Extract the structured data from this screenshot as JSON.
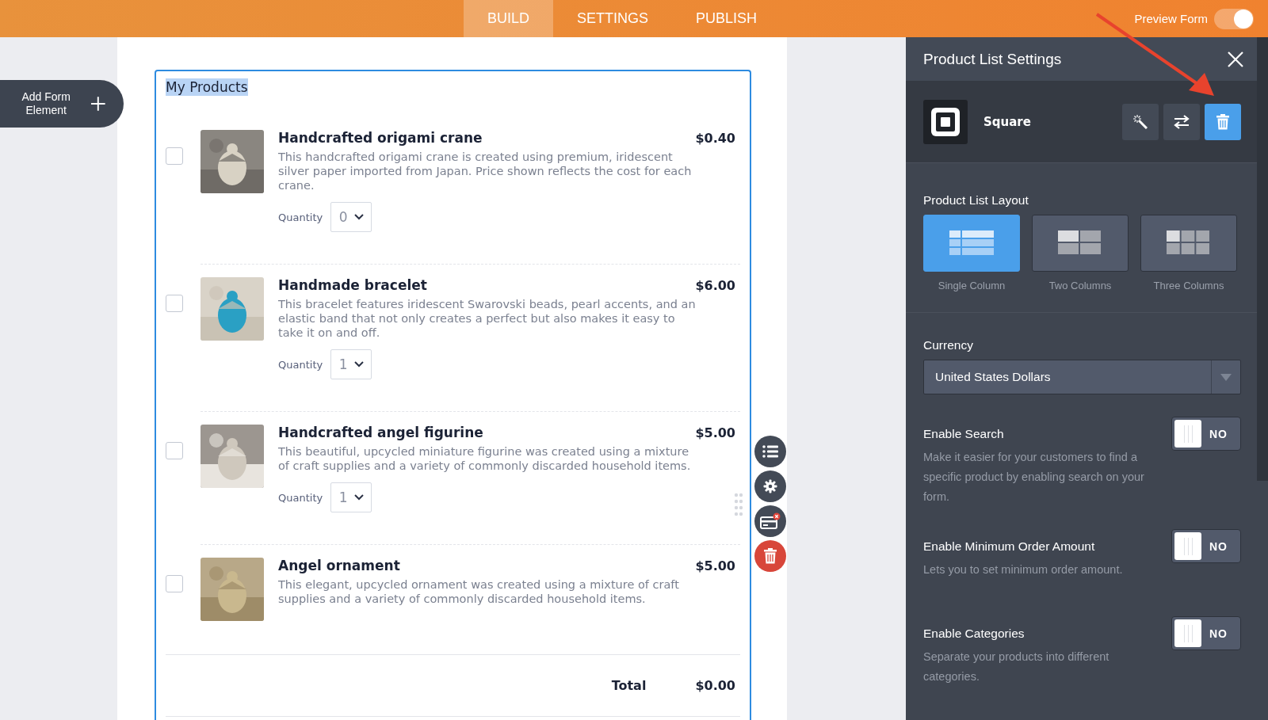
{
  "top_tabs": [
    {
      "label": "BUILD",
      "selected": true
    },
    {
      "label": "SETTINGS",
      "selected": false
    },
    {
      "label": "PUBLISH",
      "selected": false
    }
  ],
  "preview": {
    "label": "Preview Form",
    "on": true
  },
  "add_element": {
    "label": "Add Form Element"
  },
  "form": {
    "title": "My Products",
    "products": [
      {
        "name": "Handcrafted origami crane",
        "price": "$0.40",
        "description": "This handcrafted origami crane is created using premium, iridescent silver paper imported from Japan. Price shown reflects the cost for each crane.",
        "quantity_label": "Quantity",
        "quantity": "0",
        "checked": false,
        "kind": "picture"
      },
      {
        "name": "Handmade bracelet",
        "price": "$6.00",
        "description": "This bracelet features iridescent Swarovski beads, pearl accents, and an elastic band that not only creates a perfect but also makes it easy to take it on and off.",
        "quantity_label": "Quantity",
        "quantity": "1",
        "checked": false,
        "kind": "picture"
      },
      {
        "name": "Handcrafted angel figurine",
        "price": "$5.00",
        "description": "This beautiful, upcycled miniature figurine was created using a mixture of craft supplies and a variety of commonly discarded household items.",
        "quantity_label": "Quantity",
        "quantity": "1",
        "checked": false,
        "kind": "picture"
      },
      {
        "name": "Angel ornament",
        "price": "$5.00",
        "description": "This elegant, upcycled ornament was created using a mixture of craft supplies and a variety of commonly discarded household items.",
        "checked": false,
        "kind": "picture"
      }
    ],
    "total_label": "Total",
    "total": "$0.00"
  },
  "panel": {
    "title": "Product List Settings",
    "gateway": "Square",
    "layout_label": "Product List Layout",
    "layouts": [
      {
        "label": "Single Column",
        "kind": "single",
        "selected": true
      },
      {
        "label": "Two Columns",
        "kind": "two",
        "selected": false
      },
      {
        "label": "Three Columns",
        "kind": "three",
        "selected": false
      }
    ],
    "currency_label": "Currency",
    "currency": "United States Dollars",
    "toggles": [
      {
        "label": "Enable Search",
        "description": "Make it easier for your customers to find a specific product by enabling search on your form.",
        "on": false,
        "state_text": "NO"
      },
      {
        "label": "Enable Minimum Order Amount",
        "description": "Lets you to set minimum order amount.",
        "on": false,
        "state_text": "NO"
      },
      {
        "label": "Enable Categories",
        "description": "Separate your products into different categories.",
        "on": false,
        "state_text": "NO"
      }
    ]
  }
}
